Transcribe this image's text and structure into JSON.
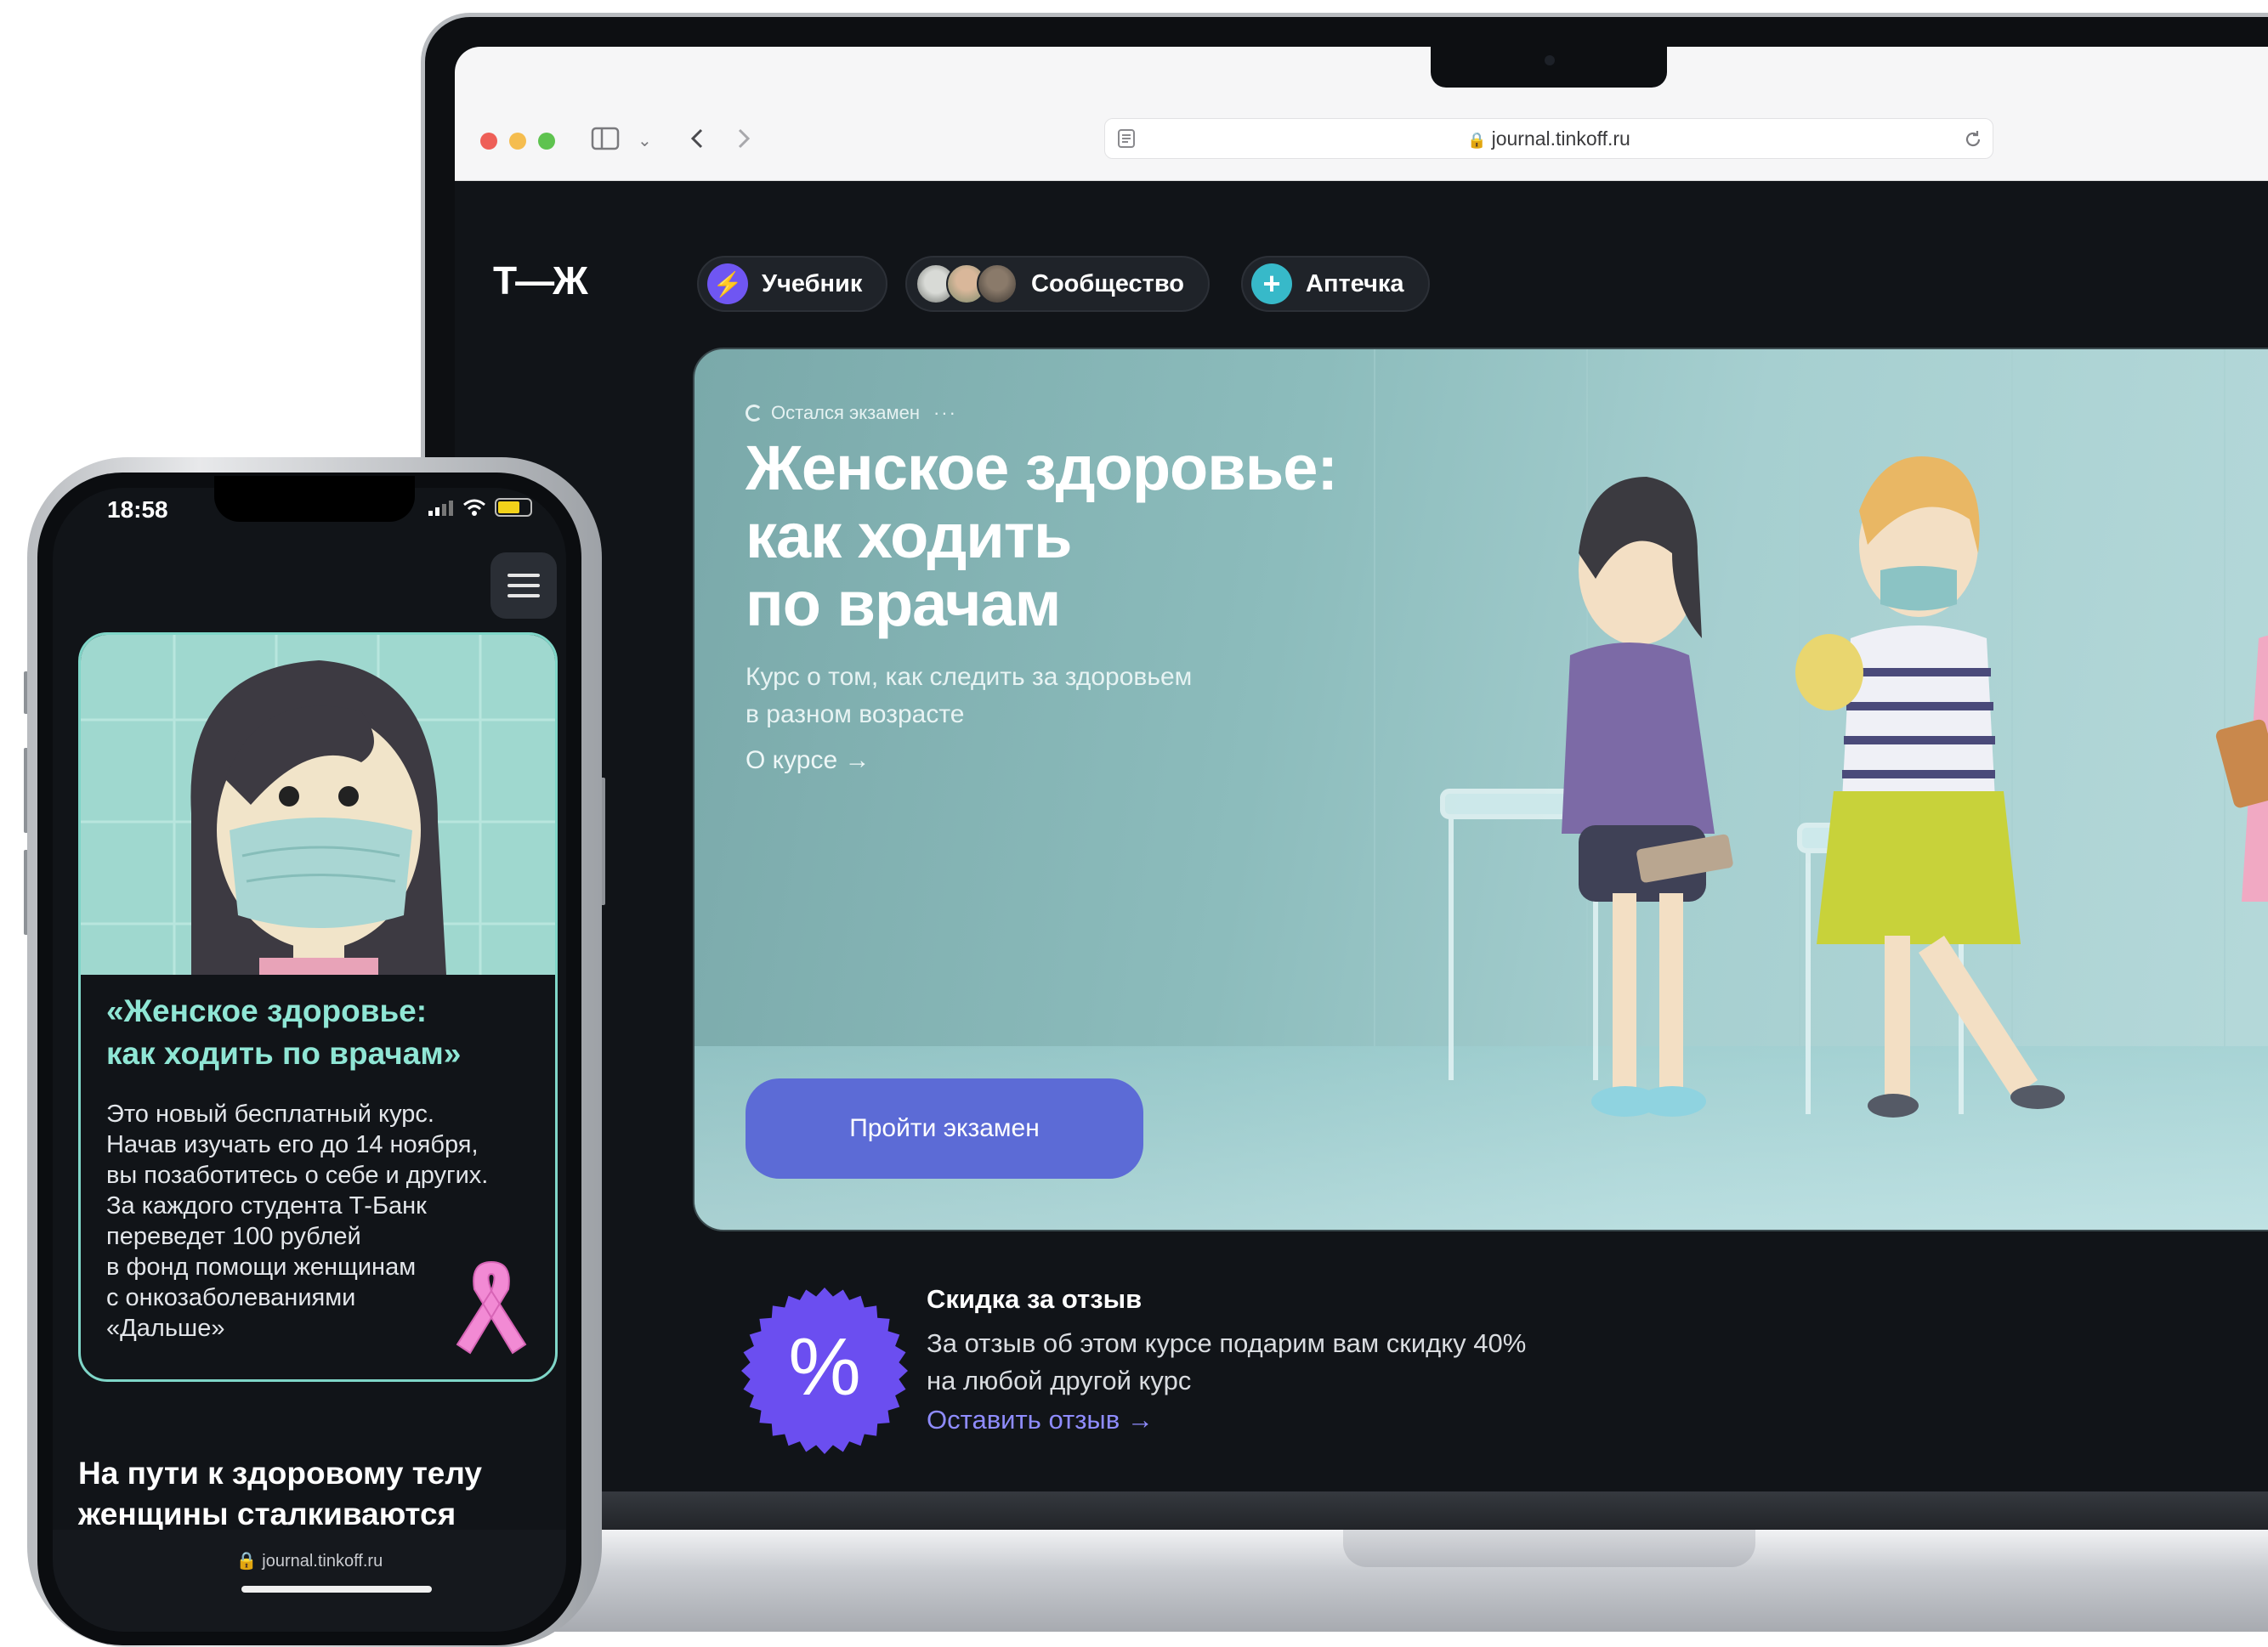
{
  "browser": {
    "url": "journal.tinkoff.ru"
  },
  "nav": {
    "logo": "Т—Ж",
    "items": [
      {
        "label": "Учебник",
        "icon": "lightning-icon"
      },
      {
        "label": "Сообщество",
        "icon": "avatars-icon"
      },
      {
        "label": "Аптечка",
        "icon": "plus-cross-icon"
      }
    ]
  },
  "hero": {
    "status": "Остался экзамен",
    "more": "···",
    "title_lines": [
      "Женское здоровье:",
      "как ходить",
      "по врачам"
    ],
    "subtitle_lines": [
      "Курс о том, как следить за здоровьем",
      "в разном возрасте"
    ],
    "about_link": "О курсе →",
    "cta": "Пройти экзамен"
  },
  "discount": {
    "badge": "%",
    "title": "Скидка за отзыв",
    "text_lines": [
      "За отзыв об этом курсе подарим вам скидку 40%",
      "на любой другой курс"
    ],
    "link": "Оставить отзыв →"
  },
  "phone": {
    "time": "18:58",
    "card_title_lines": [
      "«Женское здоровье:",
      "как ходить по врачам»"
    ],
    "card_text_lines": [
      "Это новый бесплатный курс.",
      "Начав изучать его до 14 ноября,",
      "вы позаботитесь о себе и других.",
      "За каждого студента Т-Банк",
      "переведет 100 рублей",
      "в фонд помощи женщинам",
      "с онкозаболеваниями",
      "«Дальше»"
    ],
    "heading_lines": [
      "На пути к здоровому телу",
      "женщины сталкиваются"
    ],
    "url": "journal.tinkoff.ru"
  },
  "colors": {
    "accent": "#5c6bd6",
    "badge": "#6b4ef0",
    "phone_title": "#8fe6d5",
    "link": "#8f8cff"
  }
}
